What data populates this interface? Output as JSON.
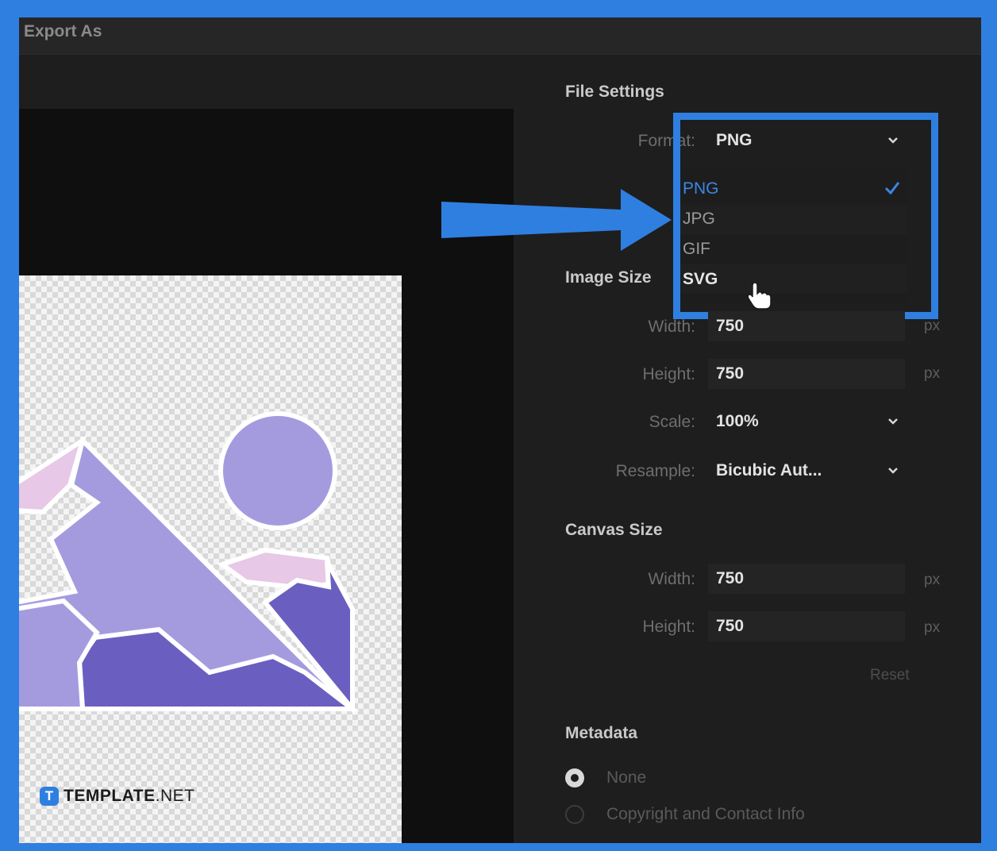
{
  "dialog": {
    "title": "Export As"
  },
  "file_settings": {
    "title": "File Settings",
    "format_label": "Format:",
    "format_value": "PNG",
    "format_options": [
      {
        "label": "PNG",
        "state": "selected"
      },
      {
        "label": "JPG",
        "state": "normal"
      },
      {
        "label": "GIF",
        "state": "normal"
      },
      {
        "label": "SVG",
        "state": "hover"
      }
    ]
  },
  "image_size": {
    "title": "Image Size",
    "width_label": "Width:",
    "width_value": "750",
    "width_unit": "px",
    "height_label": "Height:",
    "height_value": "750",
    "height_unit": "px",
    "scale_label": "Scale:",
    "scale_value": "100%",
    "resample_label": "Resample:",
    "resample_value": "Bicubic Aut..."
  },
  "canvas_size": {
    "title": "Canvas Size",
    "width_label": "Width:",
    "width_value": "750",
    "width_unit": "px",
    "height_label": "Height:",
    "height_value": "750",
    "height_unit": "px",
    "reset_label": "Reset"
  },
  "metadata": {
    "title": "Metadata",
    "options": [
      {
        "label": "None",
        "checked": true
      },
      {
        "label": "Copyright and Contact Info",
        "checked": false
      }
    ]
  },
  "watermark": {
    "badge": "T",
    "brand_bold": "TEMPLATE",
    "brand_light": ".NET"
  },
  "colors": {
    "highlight": "#2f7fe0",
    "selected_option": "#3c86e6",
    "illustration_light": "#e7c8e6",
    "illustration_mid": "#a49bdf",
    "illustration_dark": "#6a5fc0"
  }
}
